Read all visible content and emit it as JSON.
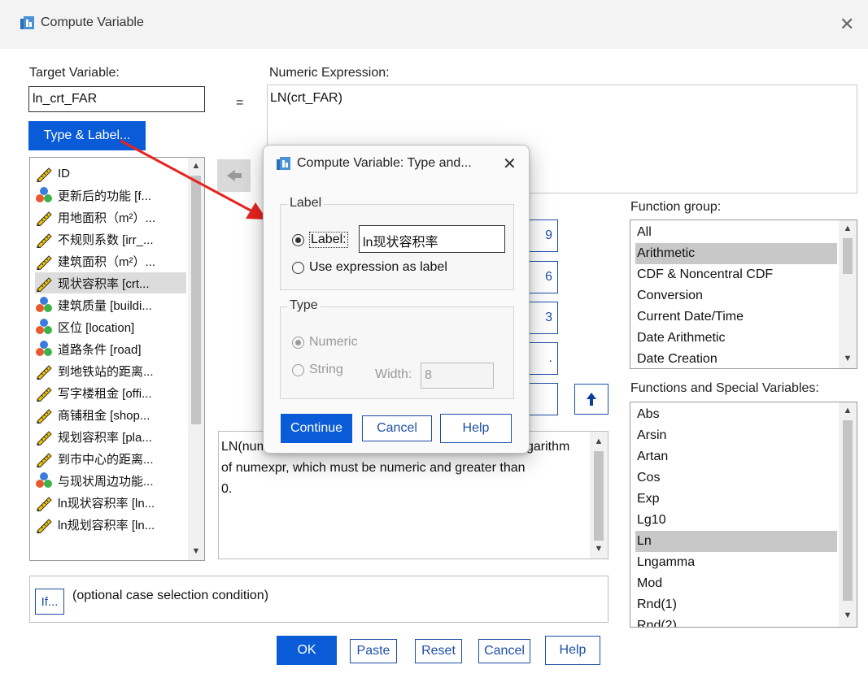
{
  "window": {
    "title": "Compute Variable"
  },
  "target": {
    "label": "Target Variable:",
    "value": "ln_crt_FAR",
    "type_label_button": "Type & Label..."
  },
  "equals": "=",
  "expression": {
    "label": "Numeric Expression:",
    "value": "LN(crt_FAR)"
  },
  "variables": [
    {
      "name": "ID",
      "icon": "scale-icon"
    },
    {
      "name": "更新后的功能 [f...",
      "icon": "nominal-icon"
    },
    {
      "name": "用地面积（m²）...",
      "icon": "scale-icon"
    },
    {
      "name": "不规则系数 [irr_...",
      "icon": "scale-icon"
    },
    {
      "name": "建筑面积（m²）...",
      "icon": "scale-icon"
    },
    {
      "name": "现状容积率 [crt...",
      "icon": "scale-icon",
      "selected": true
    },
    {
      "name": "建筑质量 [buildi...",
      "icon": "nominal-icon"
    },
    {
      "name": "区位 [location]",
      "icon": "nominal-icon"
    },
    {
      "name": "道路条件 [road]",
      "icon": "nominal-icon"
    },
    {
      "name": "到地铁站的距离...",
      "icon": "scale-icon"
    },
    {
      "name": "写字楼租金 [offi...",
      "icon": "scale-icon"
    },
    {
      "name": "商铺租金 [shop...",
      "icon": "scale-icon"
    },
    {
      "name": "规划容积率 [pla...",
      "icon": "scale-icon"
    },
    {
      "name": "到市中心的距离...",
      "icon": "scale-icon"
    },
    {
      "name": "与现状周边功能...",
      "icon": "nominal-icon"
    },
    {
      "name": "ln现状容积率 [ln...",
      "icon": "scale-icon"
    },
    {
      "name": "ln规划容积率 [ln...",
      "icon": "scale-icon"
    }
  ],
  "calculator_partial": [
    "9",
    "6",
    "3",
    ".",
    ""
  ],
  "description": {
    "line1_left": "LN(num",
    "line1_right": "garithm",
    "line2": "of numexpr, which must be numeric and greater than",
    "line3": "0."
  },
  "function_group": {
    "label": "Function group:",
    "items": [
      "All",
      "Arithmetic",
      "CDF & Noncentral CDF",
      "Conversion",
      "Current Date/Time",
      "Date Arithmetic",
      "Date Creation"
    ],
    "selected": "Arithmetic"
  },
  "functions": {
    "label": "Functions and Special Variables:",
    "items": [
      "Abs",
      "Arsin",
      "Artan",
      "Cos",
      "Exp",
      "Lg10",
      "Ln",
      "Lngamma",
      "Mod",
      "Rnd(1)",
      "Rnd(2)"
    ],
    "selected": "Ln"
  },
  "if_section": {
    "button": "If...",
    "text": "(optional case selection condition)"
  },
  "bottom_buttons": {
    "ok": "OK",
    "paste": "Paste",
    "reset": "Reset",
    "cancel": "Cancel",
    "help": "Help"
  },
  "subdialog": {
    "title": "Compute Variable: Type and...",
    "label_group": "Label",
    "label_option": "Label:",
    "label_value": "ln现状容积率",
    "use_expression": "Use expression as label",
    "type_group": "Type",
    "numeric": "Numeric",
    "string": "String",
    "width_label": "Width:",
    "width_value": "8",
    "continue": "Continue",
    "cancel": "Cancel",
    "help": "Help"
  },
  "colors": {
    "accent": "#0a5bd8",
    "link_blue": "#1d4fa6",
    "arrow_red": "#e8231f"
  }
}
